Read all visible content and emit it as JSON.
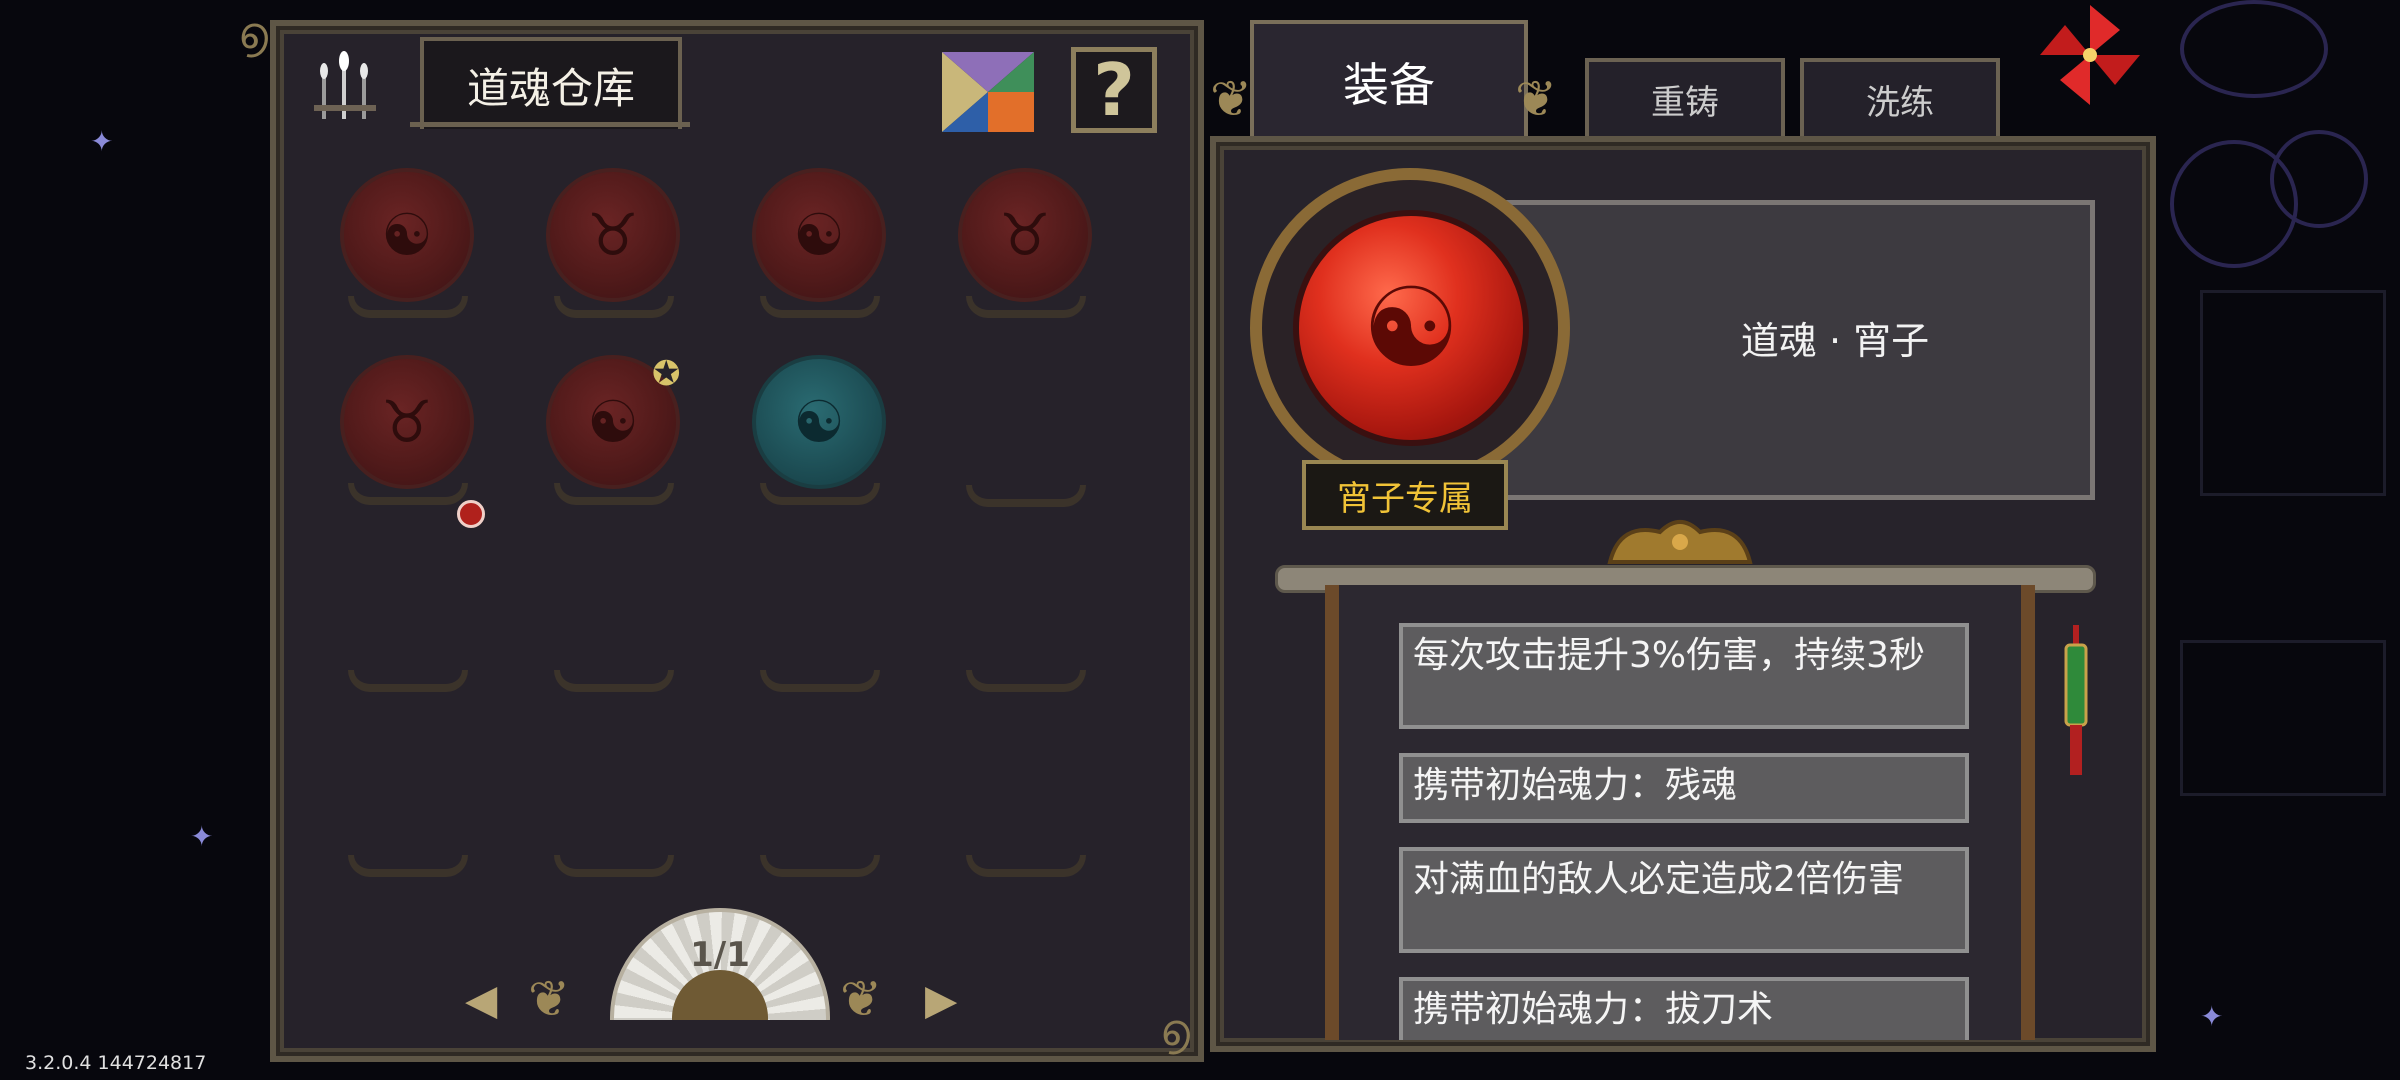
{
  "warehouse": {
    "title": "道魂仓库",
    "icons": {
      "incense": "incense-sticks-icon",
      "tangram": "tangram-icon",
      "help": "question-icon"
    },
    "help_label": "?",
    "slots": [
      {
        "state": "red",
        "glyph": "☯"
      },
      {
        "state": "red",
        "glyph": "♉"
      },
      {
        "state": "red",
        "glyph": "☯"
      },
      {
        "state": "red",
        "glyph": "♉"
      },
      {
        "state": "red",
        "glyph": "♉"
      },
      {
        "state": "red",
        "glyph": "☯"
      },
      {
        "state": "teal",
        "glyph": "☯"
      },
      {
        "state": "empty"
      },
      {
        "state": "empty"
      },
      {
        "state": "empty"
      },
      {
        "state": "empty"
      },
      {
        "state": "empty"
      },
      {
        "state": "empty"
      },
      {
        "state": "empty"
      },
      {
        "state": "empty"
      },
      {
        "state": "empty"
      }
    ],
    "pagination": {
      "label": "1/1",
      "prev": "◀",
      "next": "▶"
    }
  },
  "tabs": {
    "equip": "装备",
    "reforge": "重铸",
    "refine": "洗练"
  },
  "detail": {
    "name": "道魂 · 宵子",
    "exclusive": "宵子专属",
    "effects": [
      "每次攻击提升3%伤害，持续3秒",
      "携带初始魂力：残魂",
      "对满血的敌人必定造成2倍伤害",
      "携带初始魂力：拔刀术"
    ]
  },
  "version": "3.2.0.4 144724817",
  "colors": {
    "accent_gold": "#f1c337",
    "frame": "#5e5646",
    "orb_red": "#e0301e",
    "orb_teal": "#2a6b72"
  }
}
